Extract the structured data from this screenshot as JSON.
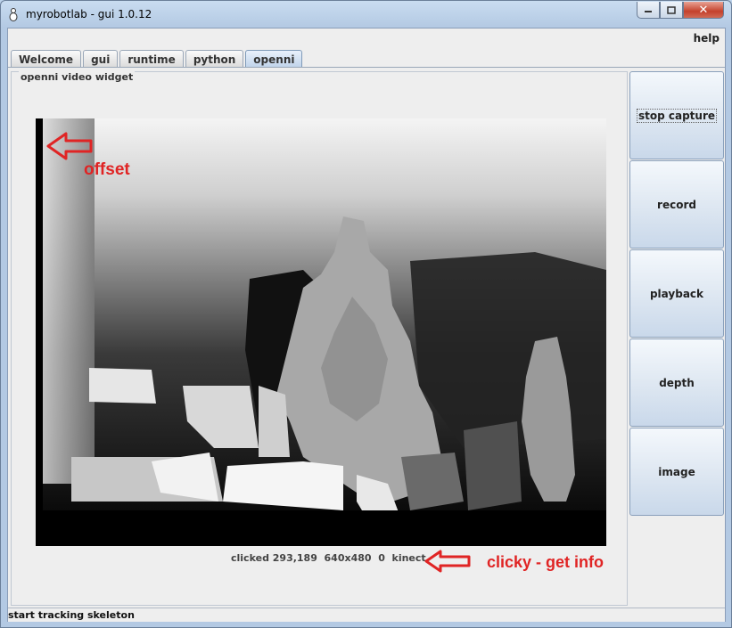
{
  "window": {
    "title": "myrobotlab - gui 1.0.12"
  },
  "menubar": {
    "help_label": "help"
  },
  "tabs": [
    {
      "label": "Welcome"
    },
    {
      "label": "gui"
    },
    {
      "label": "runtime"
    },
    {
      "label": "python"
    },
    {
      "label": "openni",
      "active": true
    }
  ],
  "widget": {
    "title": "openni  video widget",
    "info": "clicked 293,189  640x480  0  kinect"
  },
  "side_buttons": [
    {
      "label": "stop capture",
      "focused": true
    },
    {
      "label": "record"
    },
    {
      "label": "playback"
    },
    {
      "label": "depth"
    },
    {
      "label": "image"
    }
  ],
  "annotations": {
    "offset": "offset",
    "clicky": "clicky - get info",
    "color": "#e02424"
  },
  "status": {
    "text": "start tracking skeleton"
  }
}
